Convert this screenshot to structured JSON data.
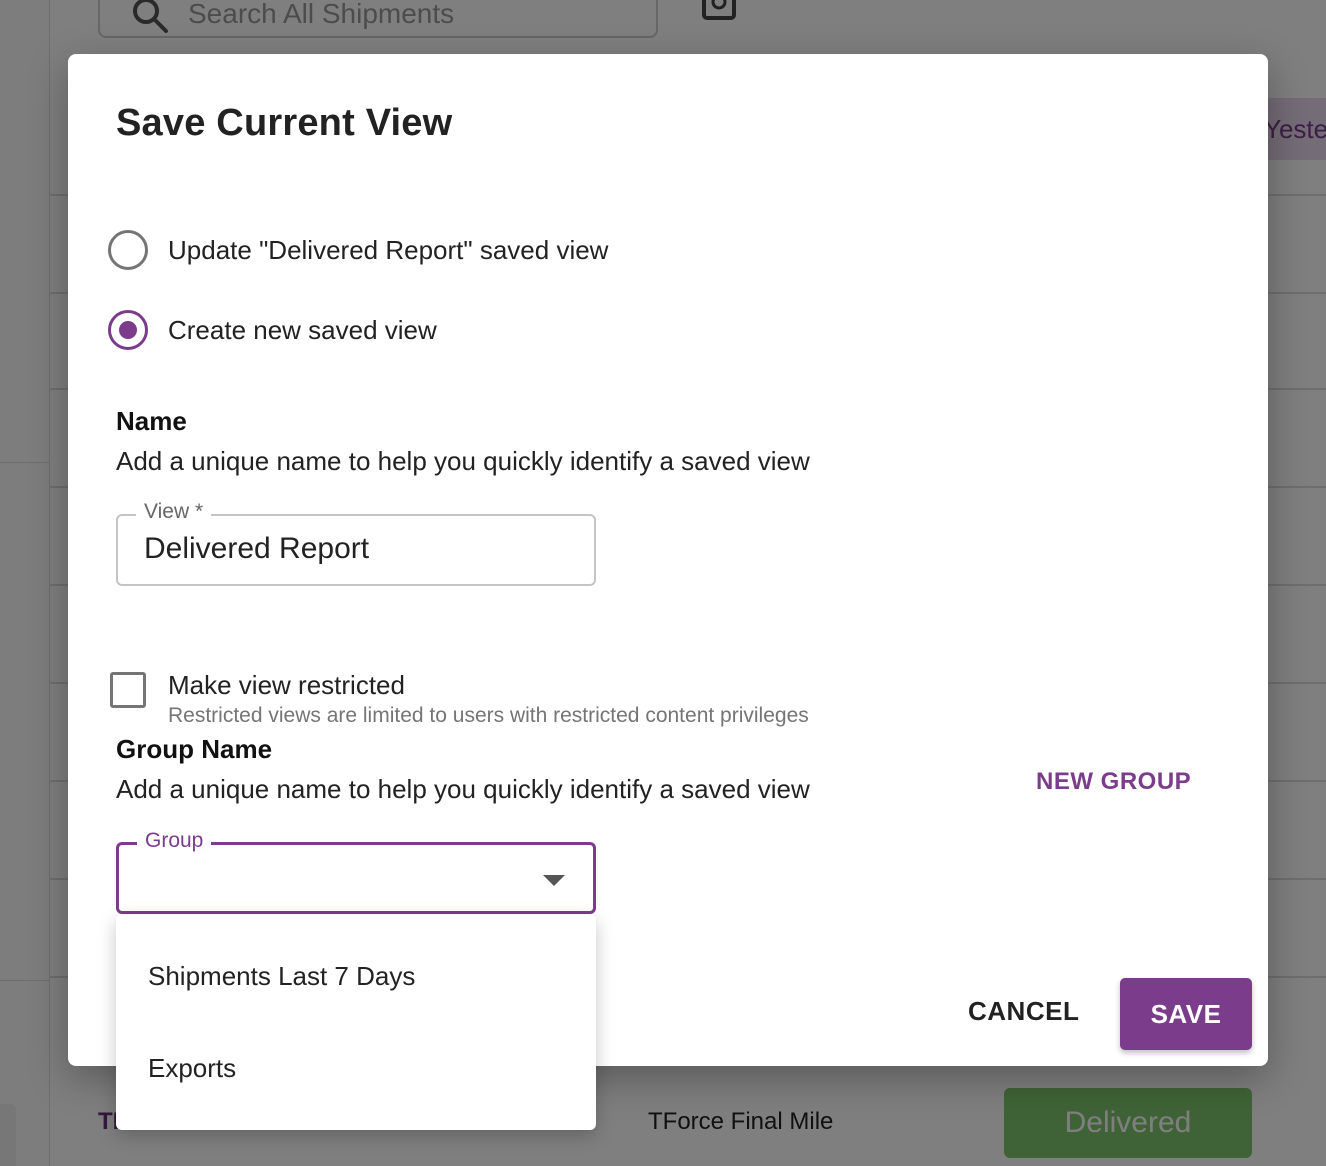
{
  "background": {
    "search_placeholder": "Search All Shipments",
    "chip_text": "Yesterday",
    "bottom_row": {
      "tracking_prefix": "TF",
      "carrier": "TForce Final Mile",
      "status": "Delivered"
    }
  },
  "dialog": {
    "title": "Save Current View",
    "options": [
      {
        "label": "Update \"Delivered Report\" saved view",
        "selected": false
      },
      {
        "label": "Create new saved view",
        "selected": true
      }
    ],
    "name_section": {
      "title": "Name",
      "description": "Add a unique name to help you quickly identify a saved view",
      "field_label": "View *",
      "field_value": "Delivered Report"
    },
    "restricted": {
      "label": "Make view restricted",
      "helper": "Restricted views are limited to users with restricted content privileges",
      "checked": false
    },
    "group_section": {
      "title": "Group Name",
      "description": "Add a unique name to help you quickly identify a saved view",
      "new_group_label": "NEW GROUP",
      "field_label": "Group",
      "field_value": ""
    },
    "actions": {
      "cancel_label": "CANCEL",
      "save_label": "SAVE"
    }
  },
  "group_menu": {
    "items": [
      "Shipments Last 7 Days",
      "Exports"
    ]
  },
  "colors": {
    "accent": "#7b3c8c",
    "status_delivered": "#7fc76f"
  }
}
